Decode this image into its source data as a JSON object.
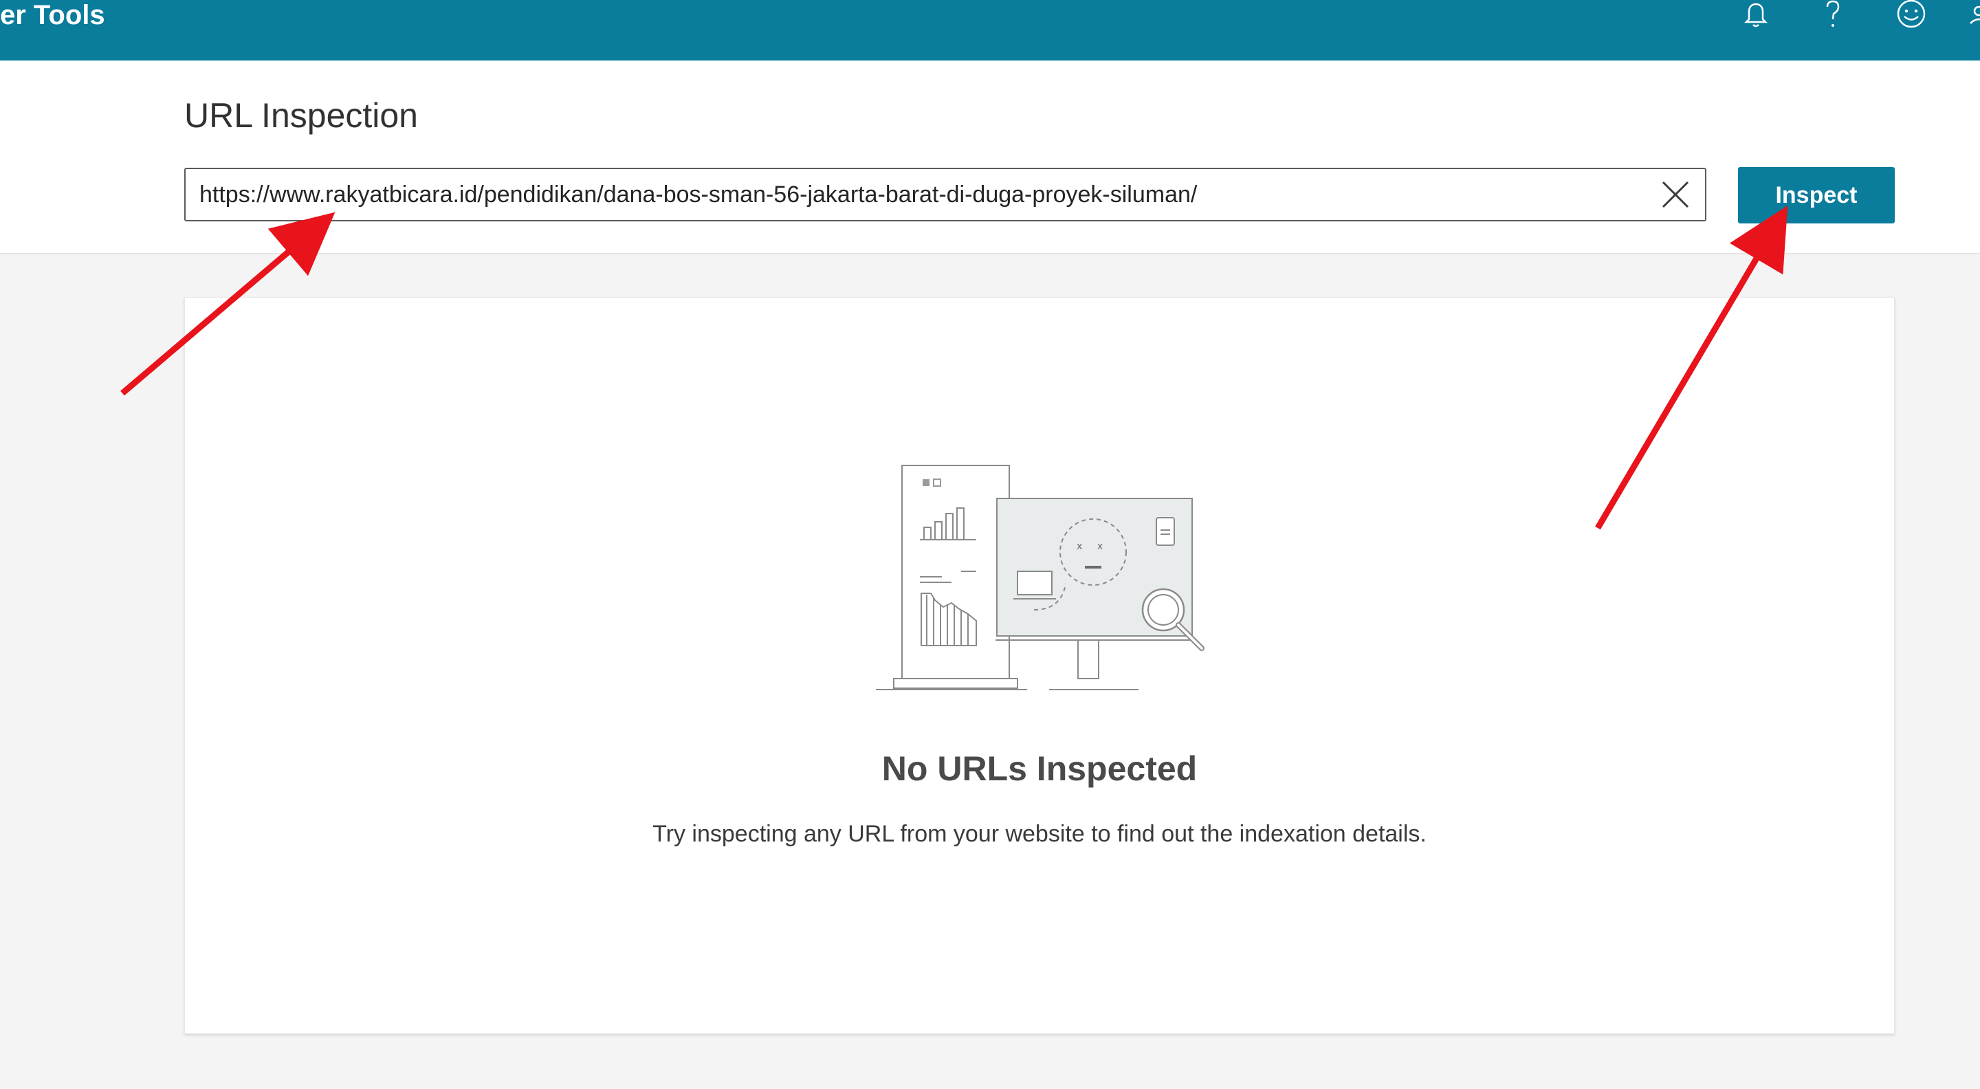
{
  "topbar": {
    "brand_text": "er Tools",
    "icons": [
      "bell-icon",
      "help-icon",
      "feedback-smiley-icon"
    ],
    "background": "#0a7c9c"
  },
  "url_inspection": {
    "title": "URL Inspection",
    "url_value": "https://www.rakyatbicara.id/pendidikan/dana-bos-sman-56-jakarta-barat-di-duga-proyek-siluman/",
    "inspect_label": "Inspect",
    "accent": "#0a7c9c"
  },
  "empty_state": {
    "title": "No URLs Inspected",
    "description": "Try inspecting any URL from your website to find out the indexation details."
  },
  "annotations": {
    "arrow_color": "#e8131b"
  }
}
